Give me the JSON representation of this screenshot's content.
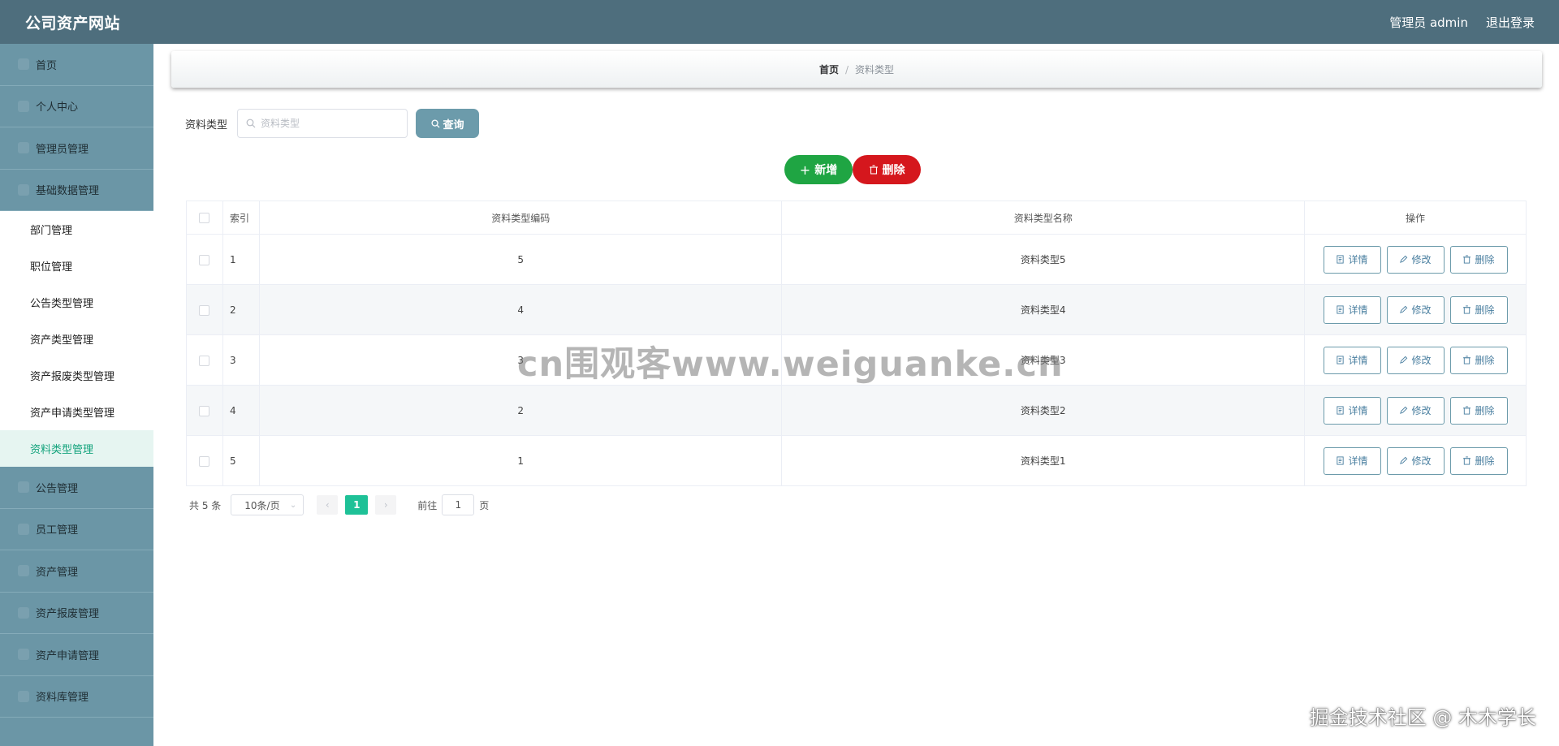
{
  "header": {
    "title": "公司资产网站",
    "user_label": "管理员 admin",
    "logout_label": "退出登录"
  },
  "sidebar": {
    "items_top": [
      {
        "label": "首页"
      },
      {
        "label": "个人中心"
      },
      {
        "label": "管理员管理"
      },
      {
        "label": "基础数据管理"
      }
    ],
    "submenu": [
      {
        "label": "部门管理"
      },
      {
        "label": "职位管理"
      },
      {
        "label": "公告类型管理"
      },
      {
        "label": "资产类型管理"
      },
      {
        "label": "资产报废类型管理"
      },
      {
        "label": "资产申请类型管理"
      },
      {
        "label": "资料类型管理",
        "active": true
      }
    ],
    "items_bottom": [
      {
        "label": "公告管理"
      },
      {
        "label": "员工管理"
      },
      {
        "label": "资产管理"
      },
      {
        "label": "资产报废管理"
      },
      {
        "label": "资产申请管理"
      },
      {
        "label": "资料库管理"
      }
    ]
  },
  "breadcrumb": {
    "home": "首页",
    "separator": "/",
    "current": "资料类型"
  },
  "search": {
    "label": "资料类型",
    "placeholder": "资料类型",
    "button_label": "查询"
  },
  "actions": {
    "add_label": "新增",
    "delete_label": "删除"
  },
  "table": {
    "headers": [
      "索引",
      "资料类型编码",
      "资料类型名称",
      "操作"
    ],
    "rows": [
      {
        "index": "1",
        "code": "5",
        "name": "资料类型5"
      },
      {
        "index": "2",
        "code": "4",
        "name": "资料类型4"
      },
      {
        "index": "3",
        "code": "3",
        "name": "资料类型3"
      },
      {
        "index": "4",
        "code": "2",
        "name": "资料类型2"
      },
      {
        "index": "5",
        "code": "1",
        "name": "资料类型1"
      }
    ],
    "row_actions": {
      "detail": "详情",
      "edit": "修改",
      "delete": "删除"
    }
  },
  "pagination": {
    "total": "共 5 条",
    "page_size": "10条/页",
    "current_page": "1",
    "goto_label": "前往",
    "goto_value": "1",
    "page_suffix": "页"
  },
  "watermarks": {
    "center": "cn围观客www.weiguanke.cn",
    "corner": "掘金技术社区 @ 木木学长"
  },
  "colors": {
    "header_bg": "#4e6e7d",
    "sidebar_bg": "#6b96a6",
    "active_text": "#13a37c",
    "add_button": "#1fa543",
    "delete_button": "#d5171d",
    "query_button": "#6c9bab",
    "page_active": "#1ec197"
  }
}
